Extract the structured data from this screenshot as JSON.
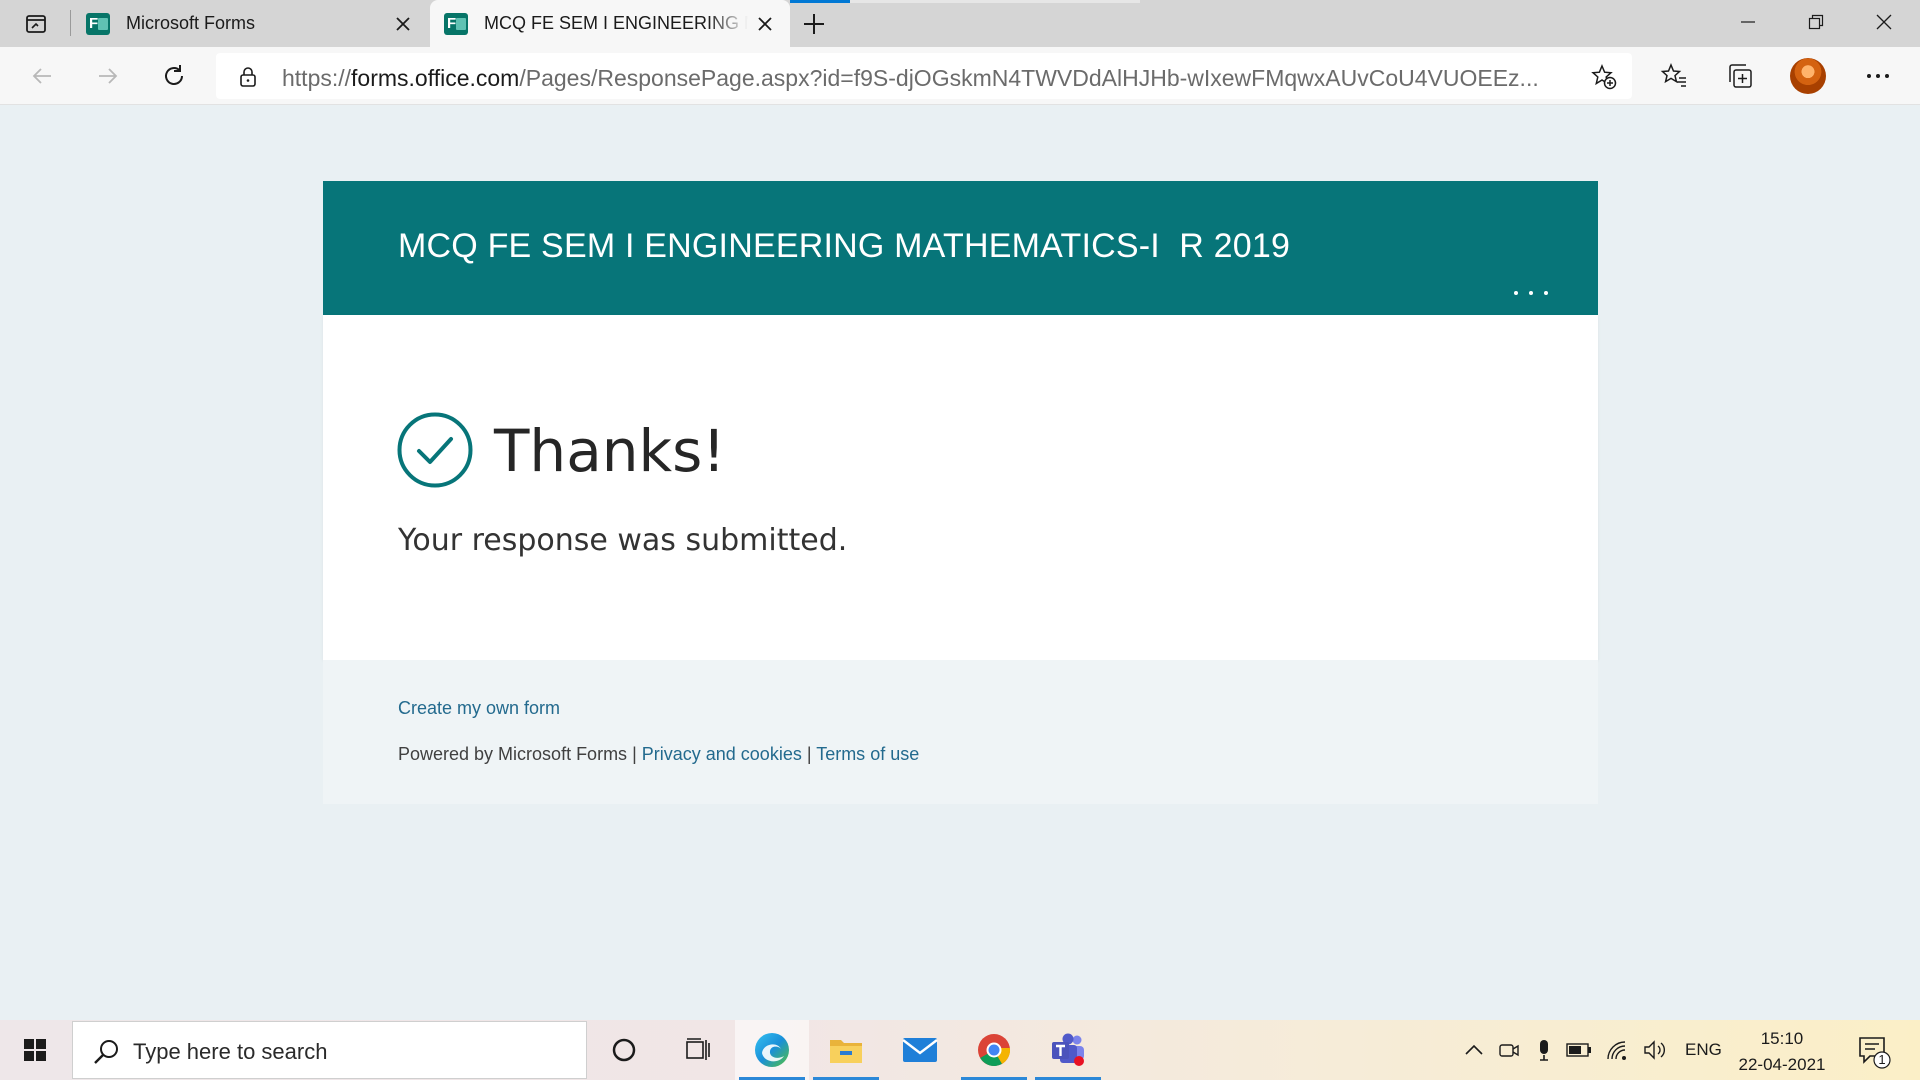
{
  "browser": {
    "tabs": [
      {
        "title": "Microsoft Forms",
        "active": false
      },
      {
        "title": "MCQ FE SEM I ENGINEERING MATHEMATICS-I  R 2019",
        "active": true
      }
    ],
    "url": {
      "scheme": "https://",
      "host": "forms.office.com",
      "path": "/Pages/ResponsePage.aspx?id=f9S-djOGskmN4TWVDdAlHJHb-wIxewFMqwxAUvCoU4VUOEEz..."
    }
  },
  "form": {
    "title": "MCQ FE SEM I ENGINEERING MATHEMATICS-I  R 2019",
    "confirmation_heading": "Thanks!",
    "confirmation_message": "Your response was submitted.",
    "accent_color": "#077579"
  },
  "footer": {
    "create_link": "Create my own form",
    "powered_by": "Powered by Microsoft Forms",
    "separator": " | ",
    "privacy_link": "Privacy and cookies",
    "terms_link": "Terms of use"
  },
  "taskbar": {
    "search_placeholder": "Type here to search",
    "apps": [
      "cortana-icon",
      "task-view-icon",
      "edge-icon",
      "file-explorer-icon",
      "mail-icon",
      "chrome-icon",
      "teams-icon"
    ],
    "language": "ENG",
    "time": "15:10",
    "date": "22-04-2021",
    "notification_count": "1"
  }
}
